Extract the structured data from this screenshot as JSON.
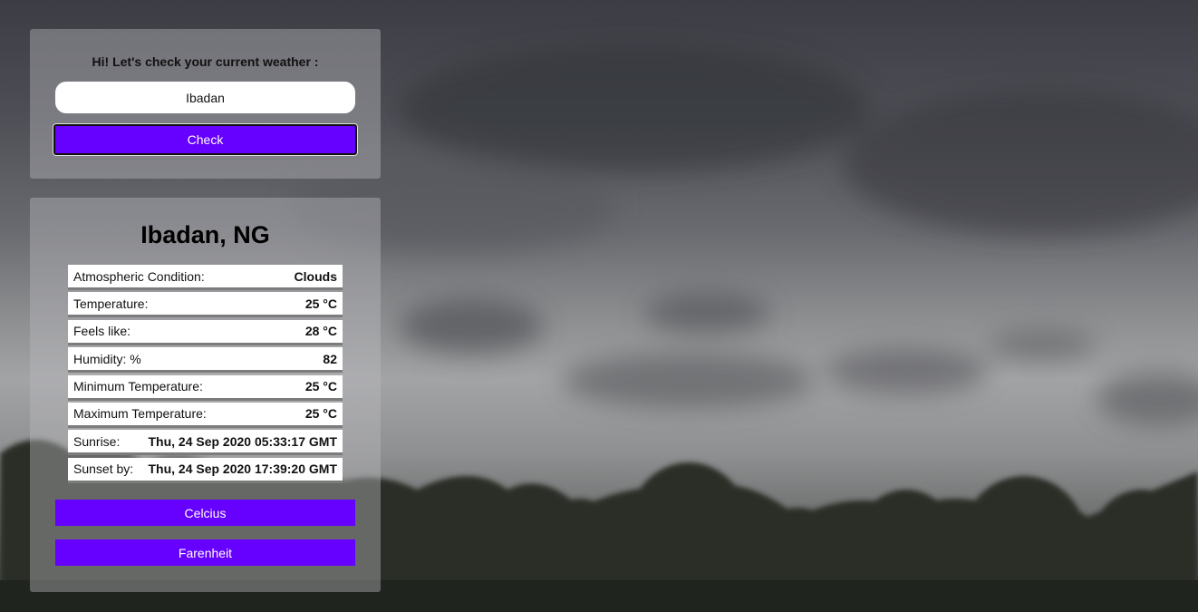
{
  "search": {
    "greeting": "Hi! Let's check your current weather :",
    "city_value": "Ibadan",
    "check_label": "Check"
  },
  "result": {
    "location": "Ibadan, NG",
    "rows": [
      {
        "label": "Atmospheric Condition:",
        "value": "Clouds"
      },
      {
        "label": "Temperature:",
        "value": "25 °C"
      },
      {
        "label": "Feels like:",
        "value": "28 °C"
      },
      {
        "label": "Humidity: %",
        "value": "82"
      },
      {
        "label": "Minimum Temperature:",
        "value": "25 °C"
      },
      {
        "label": "Maximum Temperature:",
        "value": "25 °C"
      },
      {
        "label": "Sunrise:",
        "value": "Thu, 24 Sep 2020 05:33:17 GMT"
      },
      {
        "label": "Sunset by:",
        "value": "Thu, 24 Sep 2020 17:39:20 GMT"
      }
    ],
    "celcius_label": "Celcius",
    "farenheit_label": "Farenheit"
  },
  "colors": {
    "accent": "#6600ff"
  }
}
